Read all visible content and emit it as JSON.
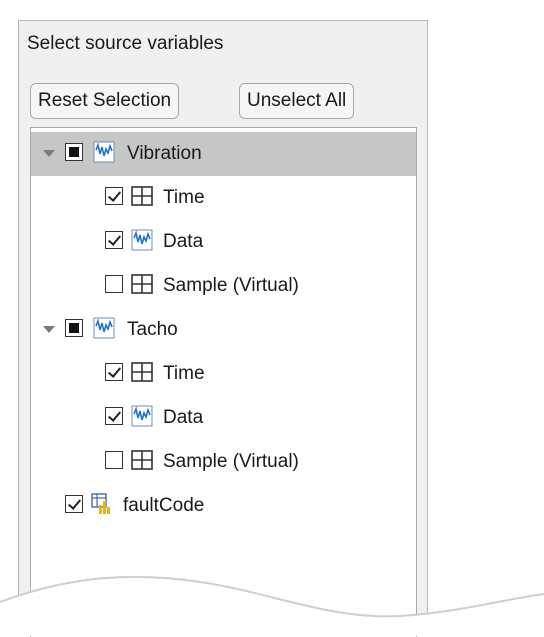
{
  "panel": {
    "title": "Select source variables",
    "reset_label": "Reset Selection",
    "unselect_label": "Unselect All"
  },
  "tree": {
    "vibration": {
      "label": "Vibration",
      "state": "partial",
      "icon": "signal-icon",
      "children": [
        {
          "label": "Time",
          "checked": true,
          "icon": "table-icon"
        },
        {
          "label": "Data",
          "checked": true,
          "icon": "signal-icon"
        },
        {
          "label": "Sample (Virtual)",
          "checked": false,
          "icon": "table-icon"
        }
      ]
    },
    "tacho": {
      "label": "Tacho",
      "state": "partial",
      "icon": "signal-icon",
      "children": [
        {
          "label": "Time",
          "checked": true,
          "icon": "table-icon"
        },
        {
          "label": "Data",
          "checked": true,
          "icon": "signal-icon"
        },
        {
          "label": "Sample (Virtual)",
          "checked": false,
          "icon": "table-icon"
        }
      ]
    },
    "faultcode": {
      "label": "faultCode",
      "checked": true,
      "icon": "variable-icon"
    }
  },
  "colors": {
    "selected_row": "#c6c6c6",
    "panel_bg": "#f0f0f0",
    "icon_blue": "#1e73c8",
    "icon_yellow": "#e8b21c"
  }
}
